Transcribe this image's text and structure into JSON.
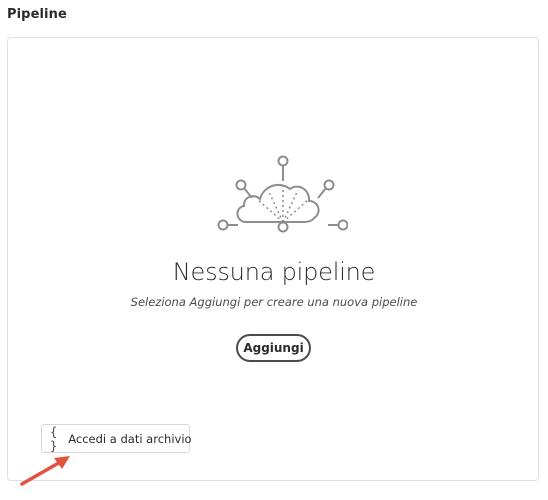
{
  "section": {
    "title": "Pipeline"
  },
  "empty_state": {
    "illustration_icon": "cloud-network-icon",
    "title": "Nessuna pipeline",
    "description": "Seleziona Aggiungi per creare una nuova pipeline",
    "add_button_label": "Aggiungi"
  },
  "archive_button": {
    "icon": "braces-icon",
    "icon_text": "{ }",
    "label": "Accedi a dati archivio"
  },
  "annotation": {
    "arrow_color": "#e0533e"
  }
}
